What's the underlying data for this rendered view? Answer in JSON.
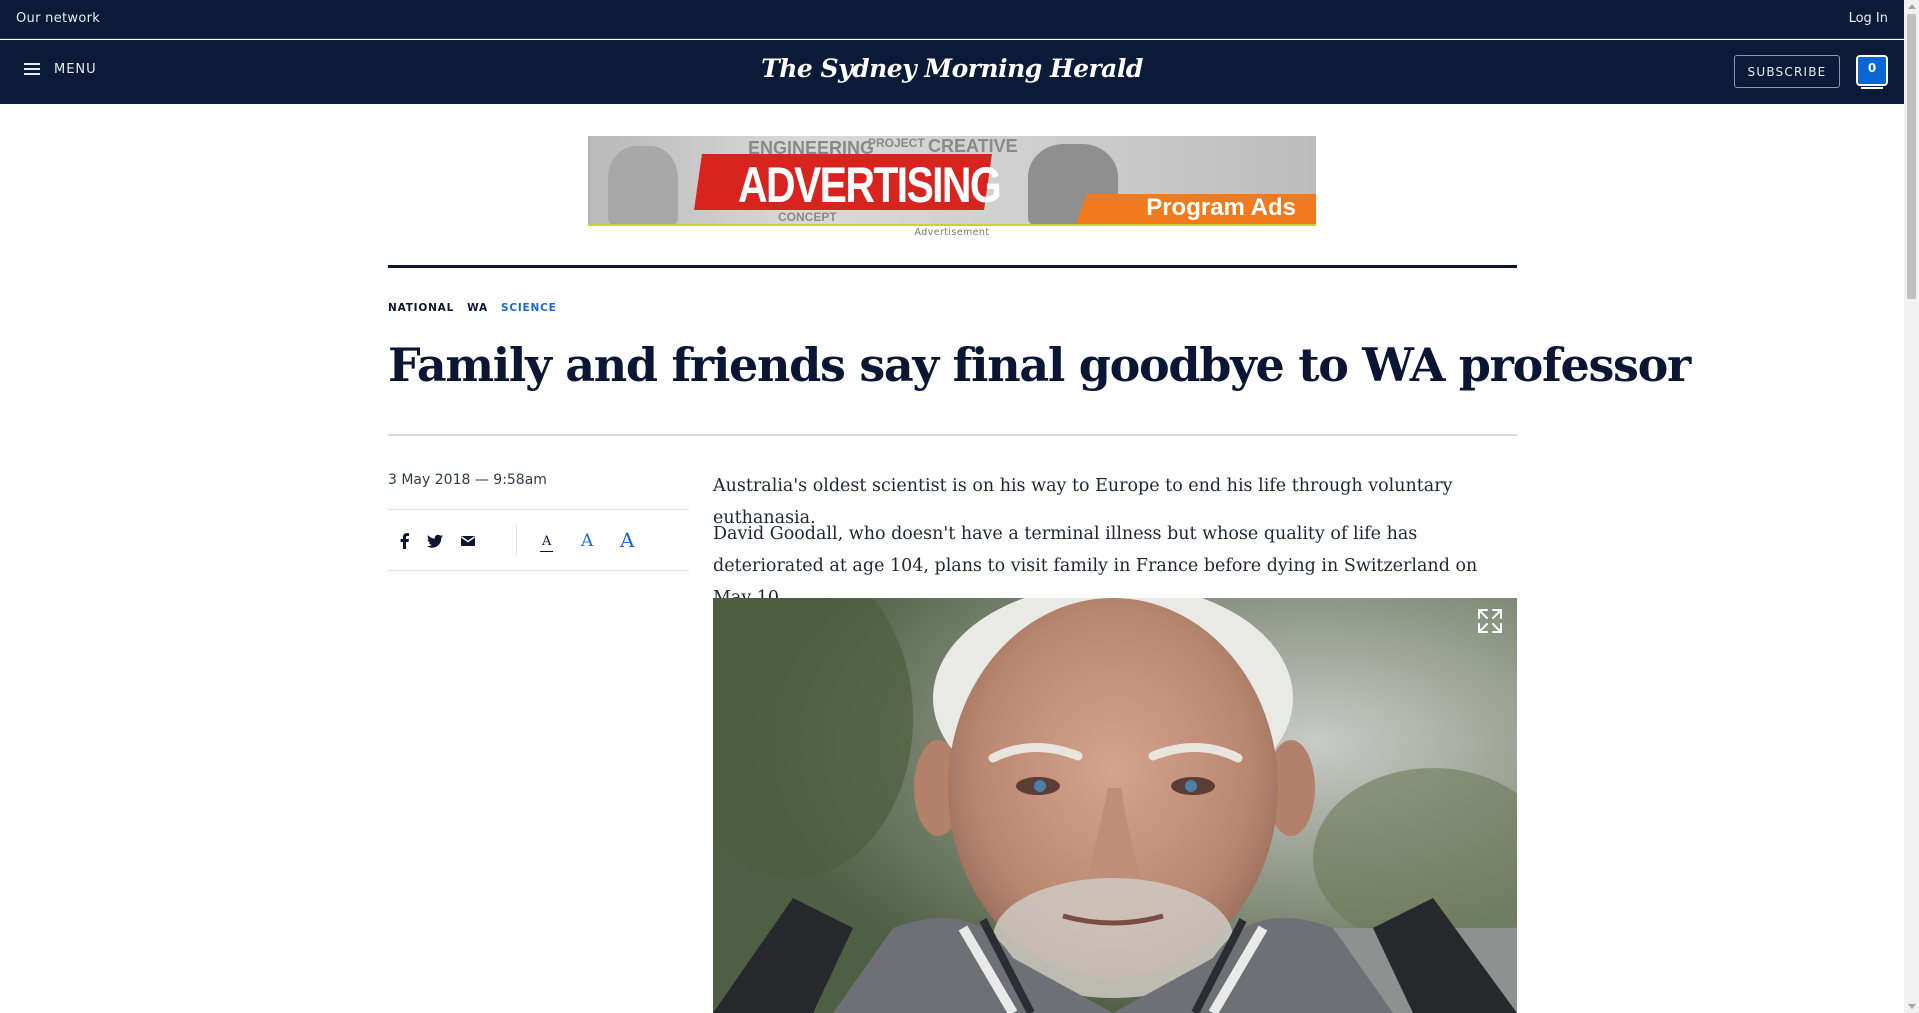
{
  "network_bar": {
    "left_label": "Our network",
    "login_label": "Log In"
  },
  "masthead": {
    "menu_label": "MENU",
    "logo_text": "The Sydney Morning Herald",
    "subscribe_label": "SUBSCRIBE",
    "notification_count": "0"
  },
  "advertisement": {
    "headline": "ADVERTISING",
    "tagline": "Program Ads",
    "background_words": [
      "ENGINEERING",
      "PROJECT",
      "CONCEPT",
      "CREATIVE"
    ],
    "label": "Advertisement"
  },
  "article": {
    "categories": [
      {
        "label": "NATIONAL",
        "active": false
      },
      {
        "label": "WA",
        "active": false
      },
      {
        "label": "SCIENCE",
        "active": true
      }
    ],
    "headline": "Family and friends say final goodbye to WA professor",
    "dateline": "3 May 2018 — 9:58am",
    "share_icons": [
      "facebook-icon",
      "twitter-icon",
      "email-icon"
    ],
    "font_size_buttons": [
      "A",
      "A",
      "A"
    ],
    "paragraphs": [
      "Australia's oldest scientist is on his way to Europe to end his life through voluntary euthanasia.",
      "David Goodall, who doesn't have a terminal illness but whose quality of life has deteriorated at age 104, plans to visit family in France before dying in Switzerland on May 10."
    ]
  },
  "colors": {
    "masthead_bg": "#0b1a36",
    "accent_blue": "#1a6ac7",
    "badge_blue": "#0a66d1"
  }
}
